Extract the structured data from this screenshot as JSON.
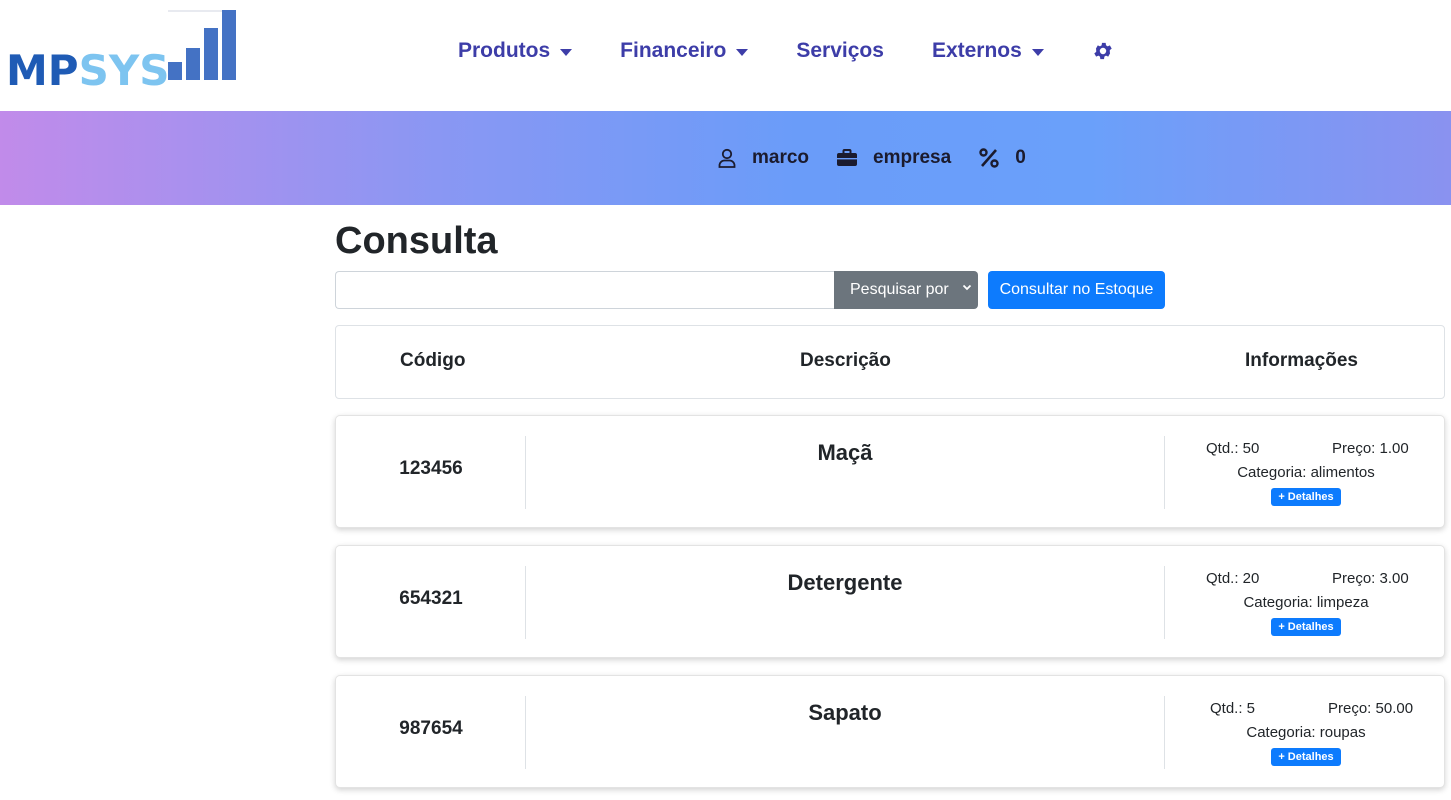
{
  "logo": {
    "part1": "MP",
    "part2": "SYS"
  },
  "nav": {
    "produtos": "Produtos",
    "financeiro": "Financeiro",
    "servicos": "Serviços",
    "externos": "Externos"
  },
  "band": {
    "user": "marco",
    "company": "empresa",
    "percent": "0"
  },
  "main": {
    "title": "Consulta",
    "search": {
      "value": "",
      "placeholder": "",
      "select_label": "Pesquisar por",
      "button": "Consultar no Estoque"
    },
    "headers": {
      "code": "Código",
      "description": "Descrição",
      "info": "Informações"
    }
  },
  "items": [
    {
      "code": "123456",
      "description": "Maçã",
      "qtd": "Qtd.: 50",
      "preco": "Preço: 1.00",
      "categoria": "Categoria: alimentos",
      "details": "+ Detalhes"
    },
    {
      "code": "654321",
      "description": "Detergente",
      "qtd": "Qtd.: 20",
      "preco": "Preço: 3.00",
      "categoria": "Categoria: limpeza",
      "details": "+ Detalhes"
    },
    {
      "code": "987654",
      "description": "Sapato",
      "qtd": "Qtd.: 5",
      "preco": "Preço: 50.00",
      "categoria": "Categoria: roupas",
      "details": "+ Detalhes"
    }
  ],
  "colors": {
    "nav_text": "#3d3da8",
    "primary": "#0d7bfd",
    "secondary": "#6c757d"
  }
}
